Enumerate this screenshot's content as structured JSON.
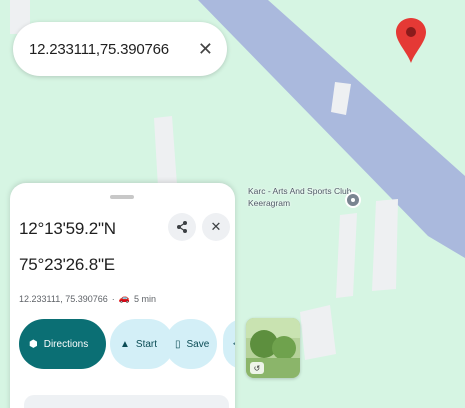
{
  "search": {
    "query": "12.233111,75.390766",
    "clear_icon": "close-icon"
  },
  "poi": {
    "name": "Karc - Arts And Sports Club Keeragram",
    "icon": "location-pin-icon"
  },
  "marker": {
    "icon": "red-map-pin-icon",
    "color": "#e53935"
  },
  "sheet": {
    "latitude": "12°13'59.2\"N",
    "longitude": "75°23'26.8\"E",
    "meta_coords": "12.233111, 75.390766",
    "meta_travel_icon": "car-icon",
    "meta_travel_time": "5 min",
    "actions": {
      "directions": "Directions",
      "start": "Start",
      "save": "Save"
    }
  },
  "colors": {
    "land": "#d6f5e3",
    "water": "#aab9dd",
    "building": "#eef0f2",
    "primary_button": "#0b6f74",
    "secondary_button": "#d3eff7"
  }
}
